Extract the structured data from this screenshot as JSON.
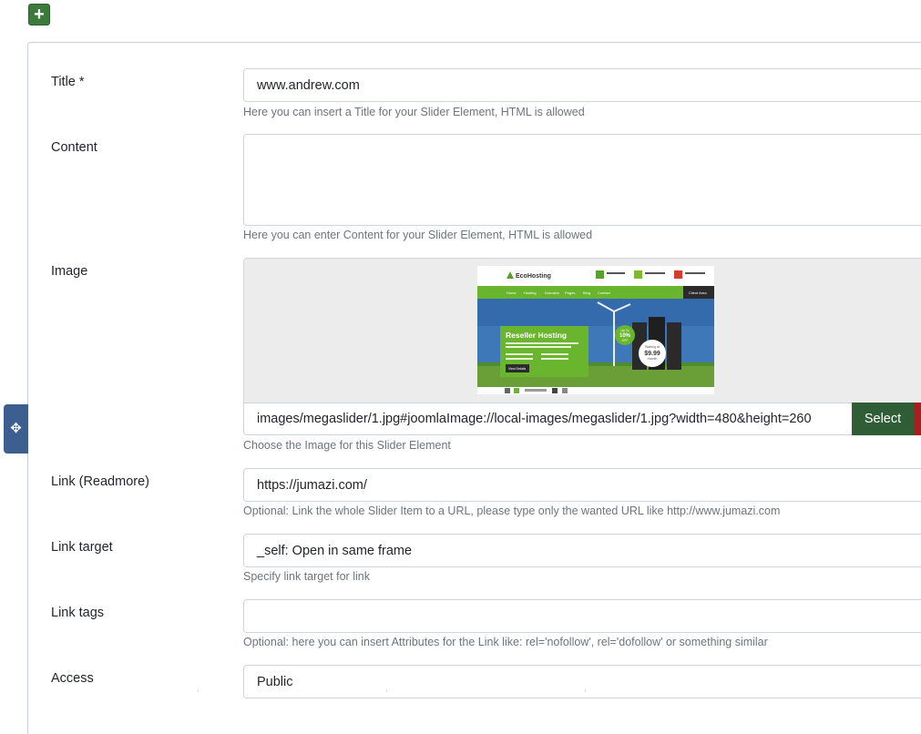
{
  "toolbar": {
    "add_label": "+"
  },
  "drag_handle": {
    "glyph": "✥"
  },
  "fields": {
    "title": {
      "label": "Title *",
      "value": "www.andrew.com",
      "help": "Here you can insert a Title for your Slider Element, HTML is allowed"
    },
    "content": {
      "label": "Content",
      "value": "",
      "help": "Here you can enter Content for your Slider Element, HTML is allowed"
    },
    "image": {
      "label": "Image",
      "value": "images/megaslider/1.jpg#joomlaImage://local-images/megaslider/1.jpg?width=480&height=260",
      "select_label": "Select",
      "help": "Choose the Image for this Slider Element",
      "preview": {
        "brand": "EcoHosting",
        "nav": [
          "Home",
          "Hosting",
          "Domains",
          "Pages",
          "Blog",
          "Contact"
        ],
        "client_area": "Client Area",
        "headline": "Reseller Hosting",
        "button": "View Details",
        "badge_top": "Up To",
        "badge_value": "10%",
        "badge_bottom": "OFF",
        "price_top": "Starting at",
        "price": "$9.99",
        "price_bottom": "/month"
      }
    },
    "link": {
      "label": "Link (Readmore)",
      "value": "https://jumazi.com/",
      "help": "Optional: Link the whole Slider Item to a URL, please type only the wanted URL like http://www.jumazi.com"
    },
    "link_target": {
      "label": "Link target",
      "value": "_self: Open in same frame",
      "help": "Specify link target for link"
    },
    "link_tags": {
      "label": "Link tags",
      "value": "",
      "help": "Optional: here you can insert Attributes for the Link like: rel='nofollow', rel='dofollow' or something similar"
    },
    "access": {
      "label": "Access",
      "value": "Public"
    }
  },
  "colors": {
    "add_button": "#3a7a3b",
    "select_button": "#2f5e36",
    "clear_button": "#a8201e",
    "drag_handle": "#3c5f8f"
  }
}
